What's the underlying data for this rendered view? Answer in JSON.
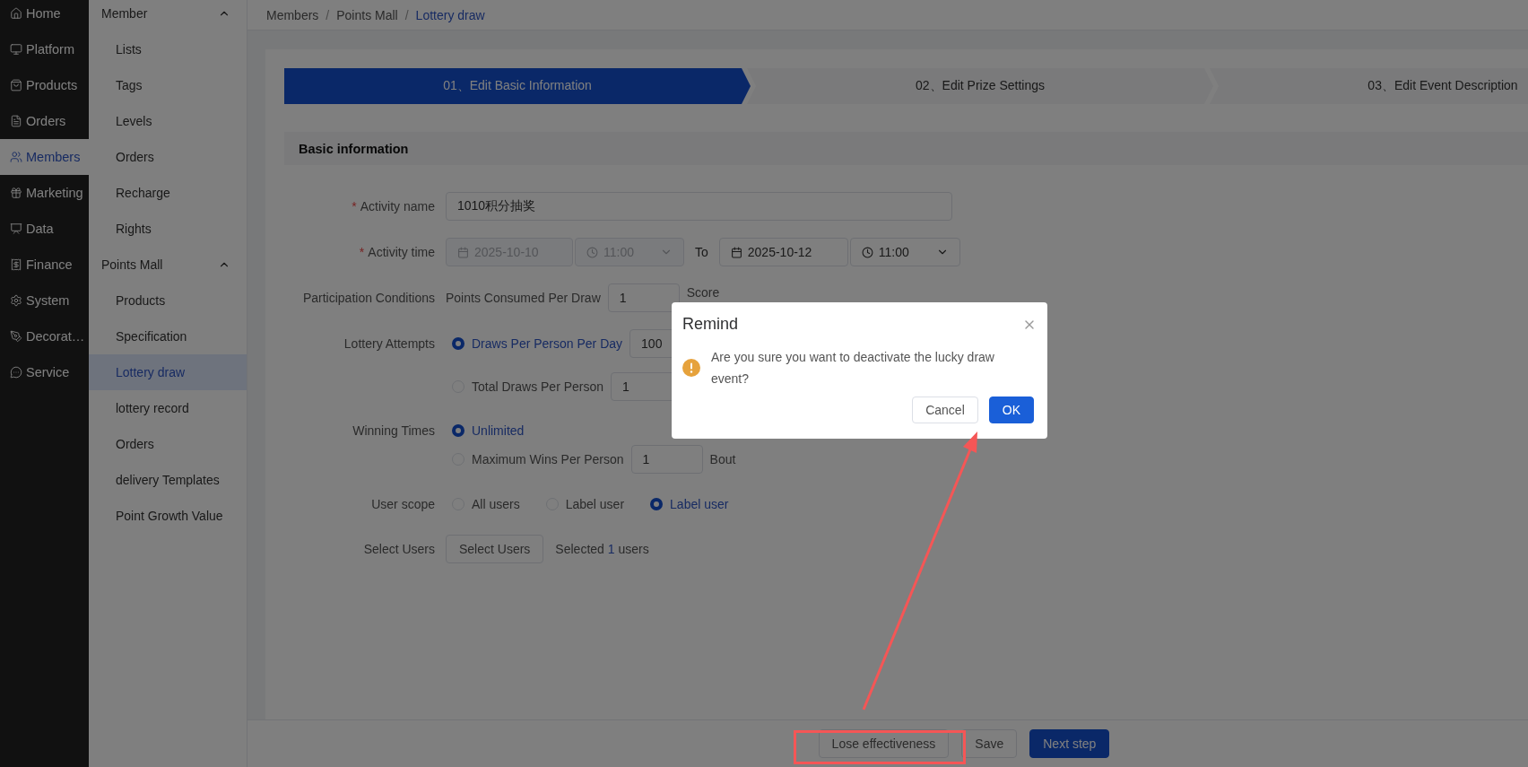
{
  "nav": {
    "items": [
      {
        "label": "Home",
        "selected": false
      },
      {
        "label": "Platform",
        "selected": false
      },
      {
        "label": "Products",
        "selected": false
      },
      {
        "label": "Orders",
        "selected": false
      },
      {
        "label": "Members",
        "selected": true
      },
      {
        "label": "Marketing",
        "selected": false
      },
      {
        "label": "Data",
        "selected": false
      },
      {
        "label": "Finance",
        "selected": false
      },
      {
        "label": "System",
        "selected": false
      },
      {
        "label": "Decorat…",
        "selected": false
      },
      {
        "label": "Service",
        "selected": false
      }
    ]
  },
  "submenu": {
    "groups": [
      {
        "title": "Member",
        "expanded": true,
        "children": [
          {
            "label": "Lists",
            "selected": false
          },
          {
            "label": "Tags",
            "selected": false
          },
          {
            "label": "Levels",
            "selected": false
          },
          {
            "label": "Orders",
            "selected": false
          },
          {
            "label": "Recharge",
            "selected": false
          },
          {
            "label": "Rights",
            "selected": false
          }
        ]
      },
      {
        "title": "Points Mall",
        "expanded": true,
        "children": [
          {
            "label": "Products",
            "selected": false
          },
          {
            "label": "Specification",
            "selected": false
          },
          {
            "label": "Lottery draw",
            "selected": true
          },
          {
            "label": "lottery record",
            "selected": false
          },
          {
            "label": "Orders",
            "selected": false
          },
          {
            "label": "delivery Templates",
            "selected": false
          },
          {
            "label": "Point Growth Value",
            "selected": false
          }
        ]
      }
    ]
  },
  "breadcrumb": {
    "separator": "/",
    "items": [
      "Members",
      "Points Mall",
      "Lottery draw"
    ]
  },
  "steps": [
    {
      "label": "01、Edit Basic Information",
      "selected": true
    },
    {
      "label": "02、Edit Prize Settings",
      "selected": false
    },
    {
      "label": "03、Edit Event Description",
      "selected": false
    }
  ],
  "section_title": "Basic information",
  "form": {
    "activity_name": {
      "label": "Activity name",
      "required_mark": "*",
      "value": "1010积分抽奖"
    },
    "activity_time": {
      "label": "Activity time",
      "required_mark": "*",
      "start": {
        "date": "2025-10-10",
        "time": "11:00",
        "disabled": true
      },
      "to": "To",
      "end": {
        "date": "2025-10-12",
        "time": "11:00",
        "disabled": false
      }
    },
    "participation": {
      "label": "Participation Conditions",
      "text": "Points Consumed Per Draw",
      "value": "1",
      "unit": "Score"
    },
    "lottery_attempts": {
      "label": "Lottery Attempts",
      "options": [
        {
          "label": "Draws Per Person Per Day",
          "selected": true,
          "value": "100"
        },
        {
          "label": "Total Draws Per Person",
          "selected": false,
          "value": "1"
        }
      ]
    },
    "winning_times": {
      "label": "Winning Times",
      "options": [
        {
          "label": "Unlimited",
          "selected": true
        },
        {
          "label": "Maximum Wins Per Person",
          "selected": false,
          "value": "1",
          "unit": "Bout"
        }
      ]
    },
    "user_scope": {
      "label": "User scope",
      "options": [
        {
          "label": "All users",
          "selected": false
        },
        {
          "label": "Label user",
          "selected": false
        },
        {
          "label": "Label user",
          "selected": true
        }
      ]
    },
    "select_users": {
      "label": "Select Users",
      "button": "Select Users",
      "prefix": "Selected",
      "count": "1",
      "suffix": "users"
    }
  },
  "footer_buttons": [
    {
      "label": "Lose effectiveness",
      "kind": "default"
    },
    {
      "label": "Save",
      "kind": "default"
    },
    {
      "label": "Next step",
      "kind": "primary"
    }
  ],
  "dialog": {
    "title": "Remind",
    "message": "Are you sure you want to deactivate the lucky draw event?",
    "buttons": [
      {
        "label": "Cancel",
        "kind": "default"
      },
      {
        "label": "OK",
        "kind": "primary"
      }
    ]
  }
}
